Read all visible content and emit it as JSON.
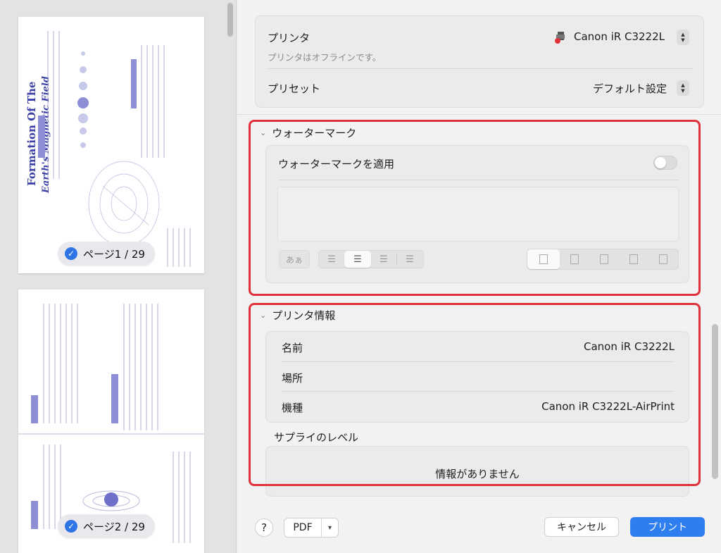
{
  "thumbnails": {
    "page1": {
      "title_line1": "Formation Of The",
      "title_line2": "Earth's Magnetic Field",
      "badge": "ページ1 / 29"
    },
    "page2": {
      "badge": "ページ2 / 29"
    }
  },
  "printer": {
    "label": "プリンタ",
    "value": "Canon iR C3222L",
    "status": "プリンタはオフラインです。",
    "preset_label": "プリセット",
    "preset_value": "デフォルト設定"
  },
  "watermark": {
    "header": "ウォーターマーク",
    "apply_label": "ウォーターマークを適用",
    "apply_enabled": false,
    "font_button": "あぁ"
  },
  "printer_info": {
    "header": "プリンタ情報",
    "name_label": "名前",
    "name_value": "Canon iR C3222L",
    "location_label": "場所",
    "location_value": "",
    "model_label": "機種",
    "model_value": "Canon iR C3222L-AirPrint"
  },
  "supply": {
    "label": "サプライのレベル",
    "message": "情報がありません"
  },
  "footer": {
    "help": "?",
    "pdf": "PDF",
    "cancel": "キャンセル",
    "print": "プリント"
  },
  "colors": {
    "accent": "#2f7ef0",
    "highlight": "#e0313b"
  }
}
